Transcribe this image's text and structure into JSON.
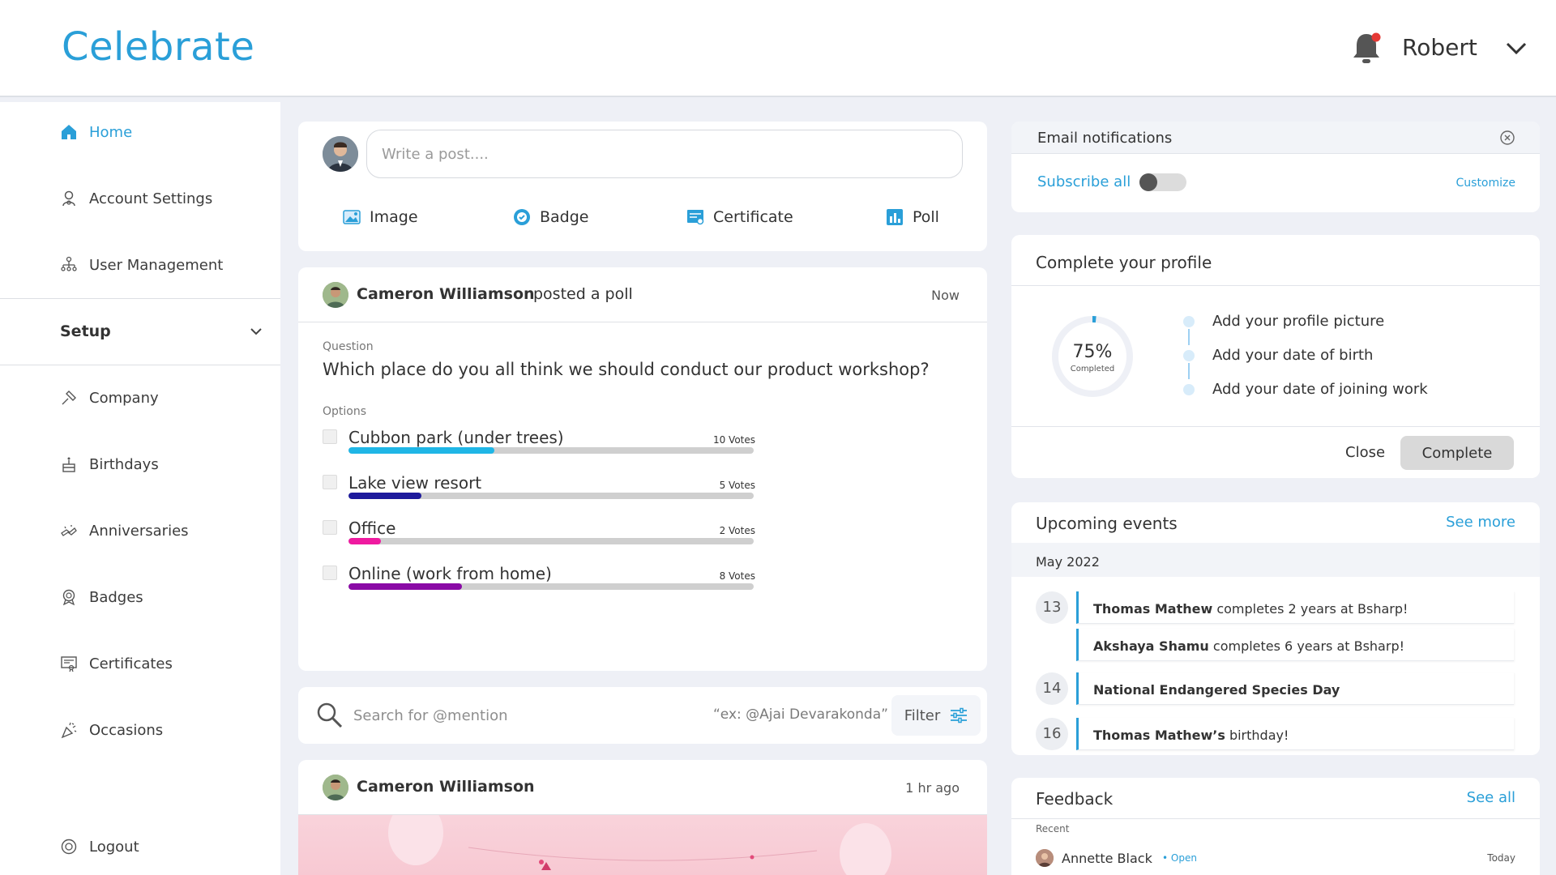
{
  "app": {
    "logo": "Celebrate"
  },
  "header": {
    "user_name": "Robert"
  },
  "sidebar": {
    "items": [
      {
        "label": "Home"
      },
      {
        "label": "Account Settings"
      },
      {
        "label": "User Management"
      }
    ],
    "setup_label": "Setup",
    "setup_items": [
      {
        "label": "Company"
      },
      {
        "label": "Birthdays"
      },
      {
        "label": "Anniversaries"
      },
      {
        "label": "Badges"
      },
      {
        "label": "Certificates"
      },
      {
        "label": "Occasions"
      }
    ],
    "logout_label": "Logout"
  },
  "composer": {
    "placeholder": "Write a post....",
    "actions": [
      {
        "label": "Image"
      },
      {
        "label": "Badge"
      },
      {
        "label": "Certificate"
      },
      {
        "label": "Poll"
      }
    ]
  },
  "poll": {
    "author": "Cameron Williamson",
    "action": "posted a poll",
    "time": "Now",
    "question_label": "Question",
    "question": "Which place do you all think we should conduct our product workshop?",
    "options_label": "Options",
    "options": [
      {
        "text": "Cubbon park (under trees)",
        "votes": "10 Votes",
        "fraction": 0.36,
        "color": "#1fb6e6"
      },
      {
        "text": "Lake view resort",
        "votes": "5 Votes",
        "fraction": 0.18,
        "color": "#1d1a9c"
      },
      {
        "text": "Office",
        "votes": "2 Votes",
        "fraction": 0.08,
        "color": "#ef1aa0"
      },
      {
        "text": "Online (work from home)",
        "votes": "8 Votes",
        "fraction": 0.28,
        "color": "#8a0aa6"
      }
    ]
  },
  "search": {
    "placeholder": "Search for @mention",
    "hint": "“ex: @Ajai Devarakonda”",
    "filter_label": "Filter"
  },
  "post": {
    "author": "Cameron Williamson",
    "time": "1 hr ago"
  },
  "email": {
    "title": "Email notifications",
    "subscribe_label": "Subscribe all",
    "customize_label": "Customize"
  },
  "profile": {
    "title": "Complete your profile",
    "percent": "75%",
    "percent_value": 0.75,
    "percent_sub": "Completed",
    "steps": [
      {
        "label": "Add your profile picture"
      },
      {
        "label": "Add your date of birth"
      },
      {
        "label": "Add your date of joining work"
      }
    ],
    "close_label": "Close",
    "complete_label": "Complete"
  },
  "events": {
    "title": "Upcoming events",
    "see_more": "See more",
    "month": "May 2022",
    "days": [
      "13",
      "14",
      "16"
    ],
    "rows": [
      {
        "name": "Thomas Mathew",
        "text": " completes 2 years at Bsharp!"
      },
      {
        "name": "Akshaya Shamu",
        "text": " completes 6 years at Bsharp!"
      },
      {
        "name": "National Endangered Species Day",
        "text": ""
      },
      {
        "name": "Thomas Mathew’s",
        "text": " birthday!"
      }
    ]
  },
  "feedback": {
    "title": "Feedback",
    "see_all": "See all",
    "recent_label": "Recent",
    "name": "Annette Black",
    "status": "• Open",
    "time": "Today"
  },
  "colors": {
    "accent": "#2a9fd8",
    "notification_dot": "#e53935"
  }
}
